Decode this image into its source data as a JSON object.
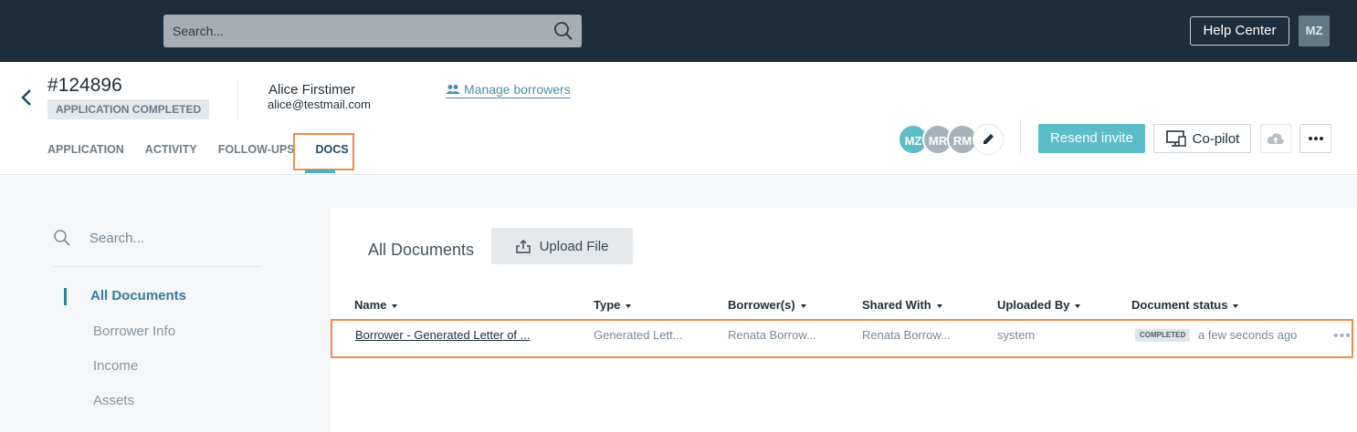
{
  "topbar": {
    "search_placeholder": "Search...",
    "help_label": "Help Center",
    "user_initials": "MZ"
  },
  "header": {
    "app_id": "#124896",
    "app_status": "APPLICATION COMPLETED",
    "borrower_name": "Alice Firstimer",
    "borrower_email": "alice@testmail.com",
    "manage_link": "Manage borrowers",
    "tabs": [
      {
        "label": "APPLICATION"
      },
      {
        "label": "ACTIVITY"
      },
      {
        "label": "FOLLOW-UPS"
      },
      {
        "label": "DOCS",
        "active": true
      }
    ],
    "avatars": [
      "MZ",
      "MR",
      "RM"
    ],
    "resend_label": "Resend invite",
    "copilot_label": "Co-pilot"
  },
  "sidebar": {
    "search_placeholder": "Search...",
    "items": [
      {
        "label": "All Documents",
        "active": true
      },
      {
        "label": "Borrower Info"
      },
      {
        "label": "Income"
      },
      {
        "label": "Assets"
      }
    ]
  },
  "documents": {
    "title": "All Documents",
    "upload_label": "Upload File",
    "columns": [
      "Name",
      "Type",
      "Borrower(s)",
      "Shared With",
      "Uploaded By",
      "Document status"
    ],
    "rows": [
      {
        "name": "Borrower - Generated Letter of ...",
        "type": "Generated Lett...",
        "borrowers": "Renata Borrow...",
        "shared_with": "Renata Borrow...",
        "uploaded_by": "system",
        "status": "COMPLETED",
        "time": "a few seconds ago"
      }
    ]
  },
  "colors": {
    "topbar_bg": "#1c2e3c",
    "accent": "#5cbcc7",
    "link": "#4b8fa6",
    "highlight": "#f08c4b"
  },
  "icons": {
    "search": "search-icon",
    "back": "back-arrow-icon",
    "users": "users-icon",
    "edit": "pencil-icon",
    "copilot": "monitor-icon",
    "cloud": "cloud-upload-icon",
    "more": "more-dots-icon",
    "upload": "upload-icon"
  }
}
